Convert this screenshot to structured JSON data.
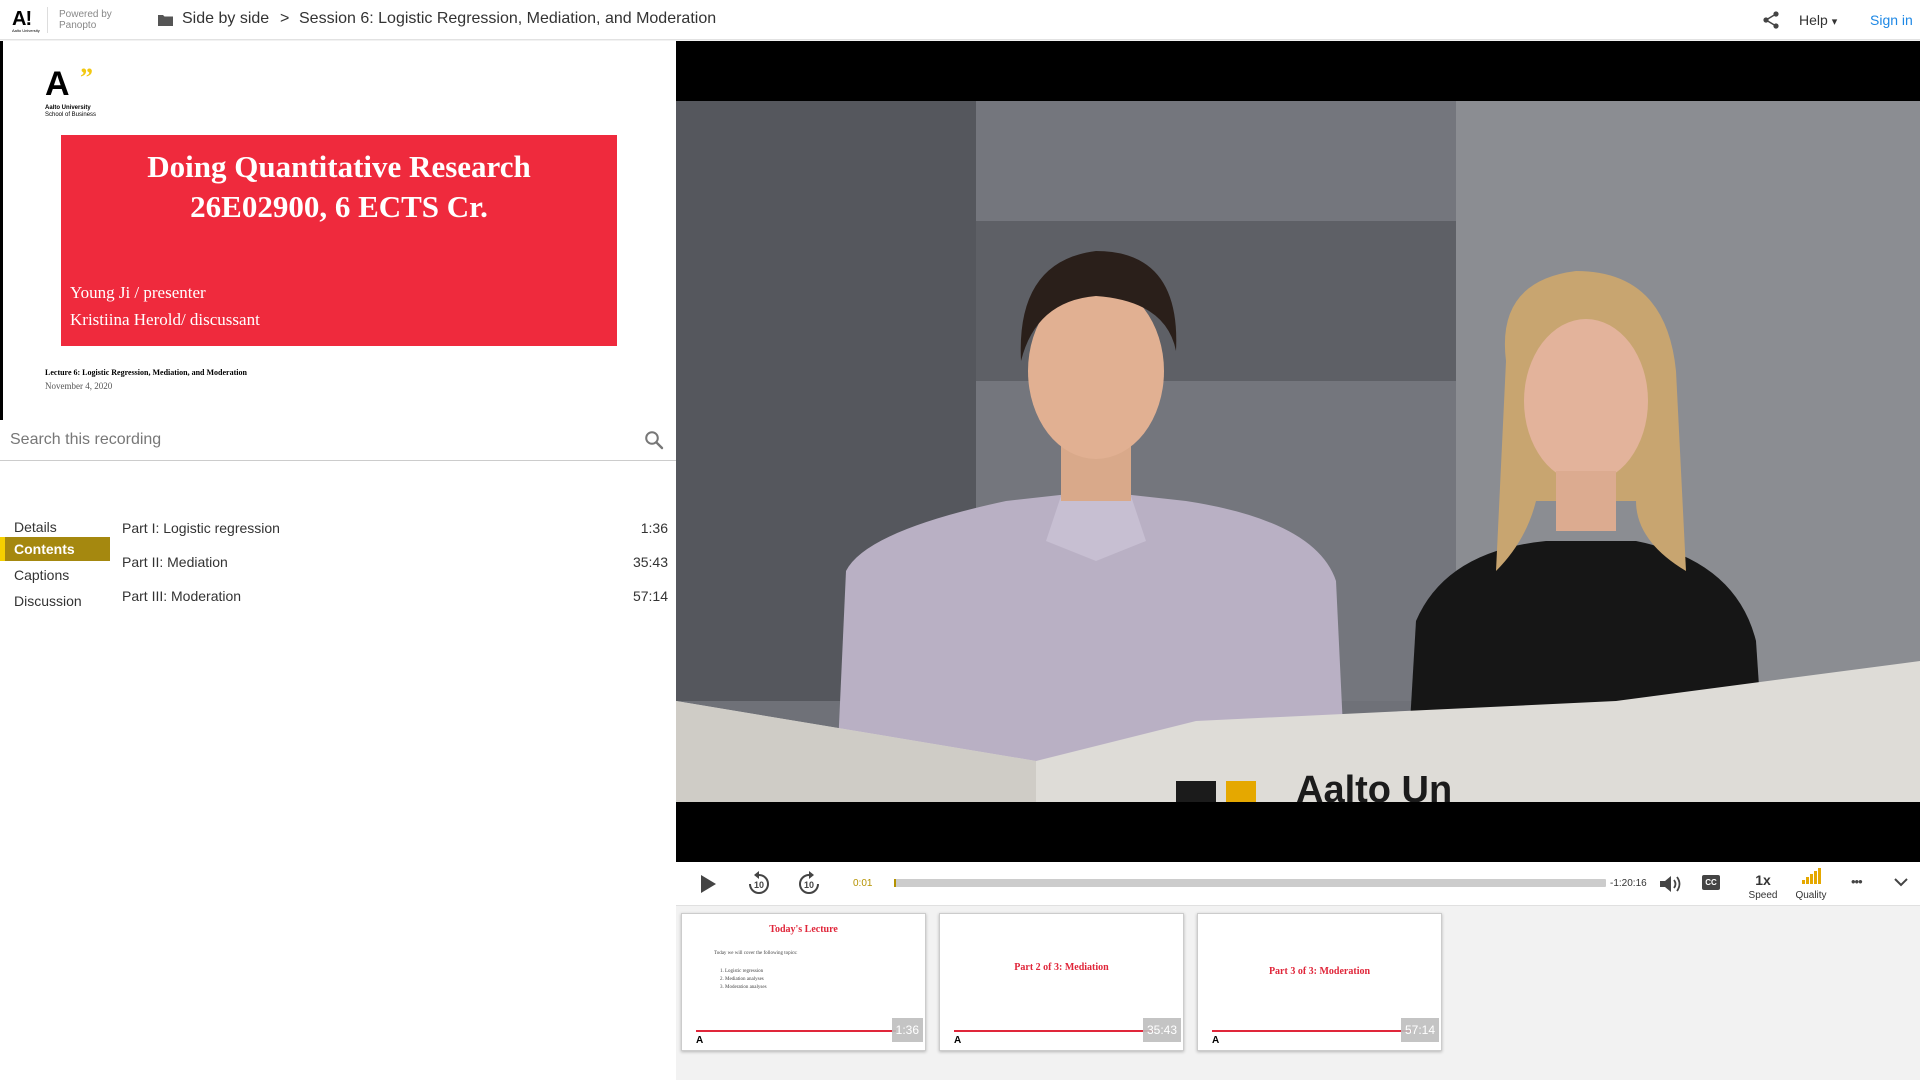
{
  "header": {
    "logo": "A!",
    "logo_sub": "Aalto University",
    "powered_by": "Powered by",
    "powered_brand": "Panopto",
    "folder": "Side by side",
    "separator": ">",
    "session": "Session 6: Logistic Regression, Mediation, and Moderation",
    "help": "Help",
    "help_caret": "▾",
    "sign_in": "Sign in"
  },
  "slide": {
    "logo": "A",
    "logo_mark": "”",
    "university": "Aalto University",
    "school": "School of Business",
    "title_line1": "Doing Quantitative Research",
    "title_line2": "26E02900, 6 ECTS Cr.",
    "presenter": "Young Ji / presenter",
    "discussant": "Kristiina Herold/ discussant",
    "lecture": "Lecture 6: Logistic Regression, Mediation, and Moderation",
    "date": "November 4, 2020"
  },
  "search": {
    "placeholder": "Search this recording"
  },
  "tabs": [
    {
      "label": "Details",
      "active": false
    },
    {
      "label": "Contents",
      "active": true
    },
    {
      "label": "Captions",
      "active": false
    },
    {
      "label": "Discussion",
      "active": false
    }
  ],
  "contents": [
    {
      "title": "Part I: Logistic regression",
      "time": "1:36"
    },
    {
      "title": "Part II: Mediation",
      "time": "35:43"
    },
    {
      "title": "Part III: Moderation",
      "time": "57:14"
    }
  ],
  "video": {
    "sign_text": "Aalto Un"
  },
  "controls": {
    "elapsed": "0:01",
    "remaining": "-1:20:16",
    "progress_fraction": 0.002,
    "speed_value": "1x",
    "speed_label": "Speed",
    "quality_label": "Quality",
    "rewind_seconds": "10",
    "forward_seconds": "10",
    "cc": "CC",
    "more": "•••"
  },
  "thumbnails": [
    {
      "title": "Today's Lecture",
      "intro": "Today we will cover the following topics:",
      "items": [
        "1.    Logistic regression",
        "2.    Mediation analyses",
        "3.    Moderation analyses"
      ],
      "time": "1:36"
    },
    {
      "title": "Part 2 of 3: Mediation",
      "time": "35:43"
    },
    {
      "title": "Part 3 of 3: Moderation",
      "time": "57:14"
    }
  ],
  "colors": {
    "accent_gold": "#b59200",
    "tab_active": "#a5880f",
    "slide_red": "#ef2a3d",
    "link_blue": "#1e88e5"
  }
}
